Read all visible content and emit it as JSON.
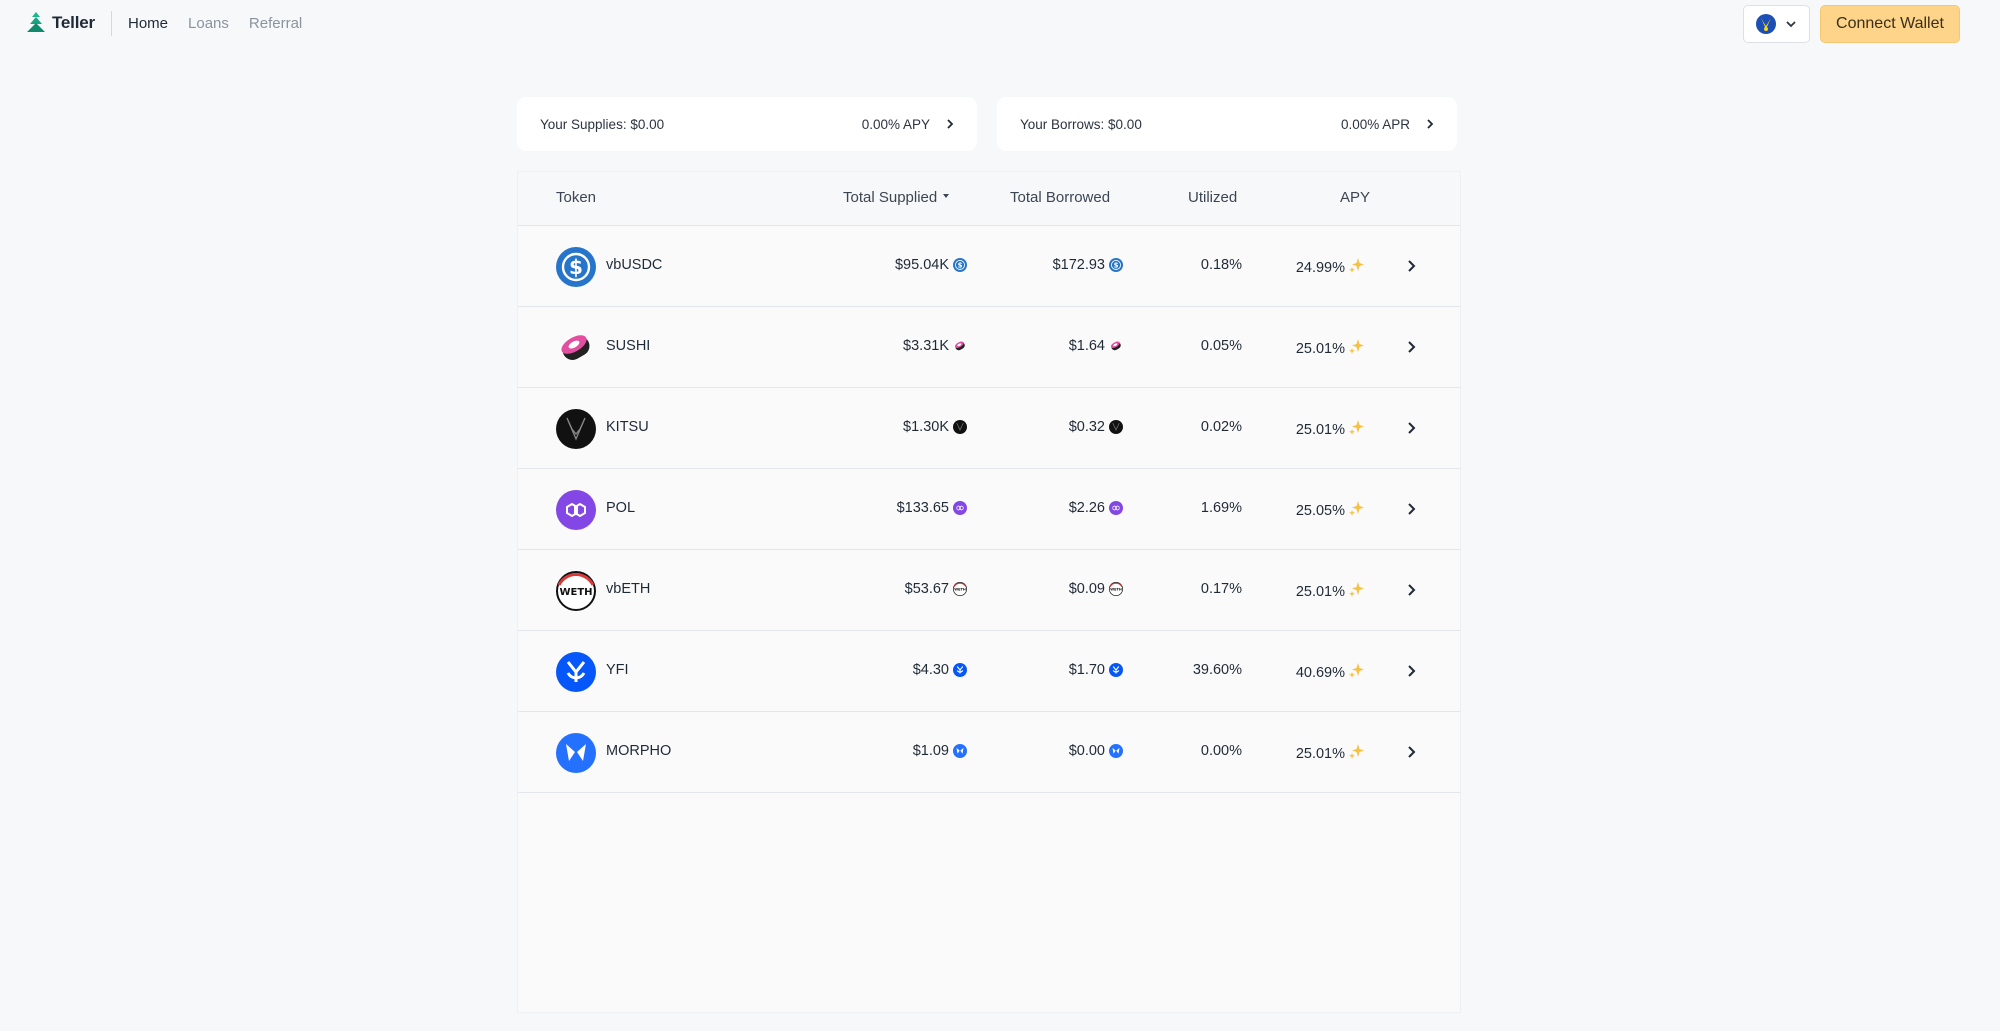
{
  "header": {
    "logo_text": "Teller",
    "nav": [
      "Home",
      "Loans",
      "Referral"
    ],
    "active_nav": "Home",
    "connect_label": "Connect Wallet"
  },
  "summary": {
    "supplies_label": "Your Supplies: $0.00",
    "supplies_rate": "0.00% APY",
    "borrows_label": "Your Borrows: $0.00",
    "borrows_rate": "0.00% APR"
  },
  "table": {
    "columns": {
      "token": "Token",
      "total_supplied": "Total Supplied",
      "total_borrowed": "Total Borrowed",
      "utilized": "Utilized",
      "apy": "APY"
    },
    "sort_column": "total_supplied",
    "rows": [
      {
        "token": "vbUSDC",
        "icon": "usdc-icon",
        "color": "#2775ca",
        "supplied": "$95.04K",
        "borrowed": "$172.93",
        "utilized": "0.18%",
        "apy": "24.99%"
      },
      {
        "token": "SUSHI",
        "icon": "sushi-icon",
        "color": "#e24fa0",
        "supplied": "$3.31K",
        "borrowed": "$1.64",
        "utilized": "0.05%",
        "apy": "25.01%"
      },
      {
        "token": "KITSU",
        "icon": "kitsu-icon",
        "color": "#111111",
        "supplied": "$1.30K",
        "borrowed": "$0.32",
        "utilized": "0.02%",
        "apy": "25.01%"
      },
      {
        "token": "POL",
        "icon": "pol-icon",
        "color": "#8247e5",
        "supplied": "$133.65",
        "borrowed": "$2.26",
        "utilized": "1.69%",
        "apy": "25.05%"
      },
      {
        "token": "vbETH",
        "icon": "weth-icon",
        "color": "#111111",
        "supplied": "$53.67",
        "borrowed": "$0.09",
        "utilized": "0.17%",
        "apy": "25.01%"
      },
      {
        "token": "YFI",
        "icon": "yfi-icon",
        "color": "#0657f9",
        "supplied": "$4.30",
        "borrowed": "$1.70",
        "utilized": "39.60%",
        "apy": "40.69%"
      },
      {
        "token": "MORPHO",
        "icon": "morpho-icon",
        "color": "#2470ff",
        "supplied": "$1.09",
        "borrowed": "$0.00",
        "utilized": "0.00%",
        "apy": "25.01%"
      }
    ]
  },
  "colors": {
    "accent_logo": "#1fb58e",
    "connect_button": "#fdd48a",
    "background": "#f7f8fa"
  }
}
